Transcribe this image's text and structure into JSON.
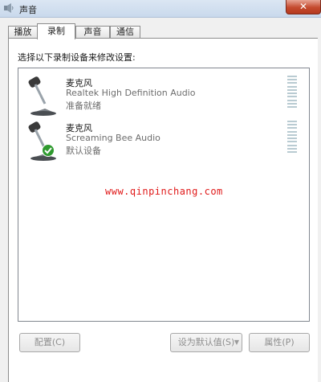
{
  "window": {
    "title": "声音",
    "close_label": "✕"
  },
  "tabs": [
    {
      "label": "播放"
    },
    {
      "label": "录制"
    },
    {
      "label": "声音"
    },
    {
      "label": "通信"
    }
  ],
  "panel": {
    "instruction": "选择以下录制设备来修改设置:"
  },
  "devices": [
    {
      "name": "麦克风",
      "driver": "Realtek High Definition Audio",
      "status": "准备就绪"
    },
    {
      "name": "麦克风",
      "driver": "Screaming Bee Audio",
      "status": "默认设备"
    }
  ],
  "watermark": "www.qinpinchang.com",
  "buttons": {
    "configure": "配置(C)",
    "set_default": "设为默认值(S)",
    "properties": "属性(P)"
  }
}
